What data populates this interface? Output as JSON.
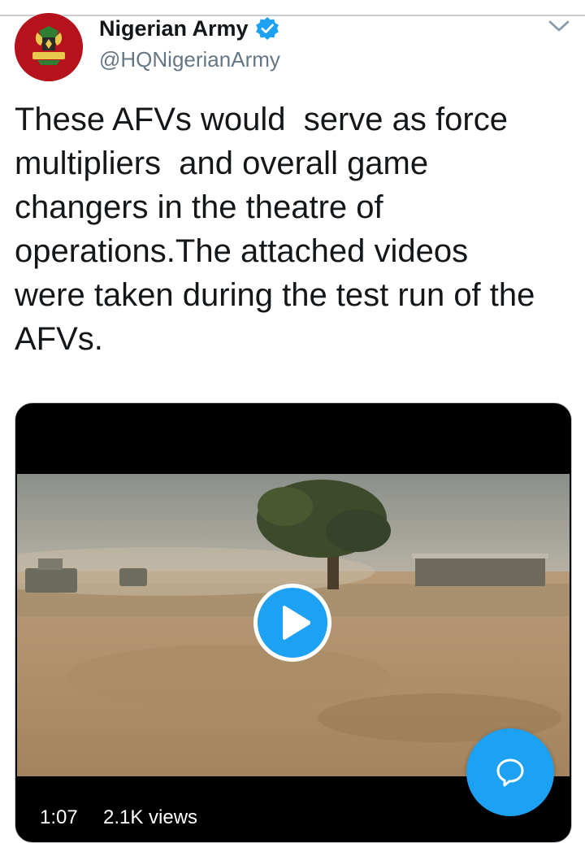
{
  "account": {
    "display_name": "Nigerian Army",
    "handle": "@HQNigerianArmy",
    "avatar_icon": "nigerian-army-crest",
    "verified_icon": "verified-badge-icon"
  },
  "tweet": {
    "text": "These AFVs would  serve as force\nmultipliers  and overall game\nchangers in the theatre of\noperations.The attached videos\nwere taken during the test run of the\nAFVs."
  },
  "video": {
    "duration": "1:07",
    "views": "2.1K views"
  },
  "colors": {
    "accent": "#1da1f2",
    "avatar_bg": "#b5121b",
    "text_primary": "#14171a",
    "text_secondary": "#657786"
  }
}
